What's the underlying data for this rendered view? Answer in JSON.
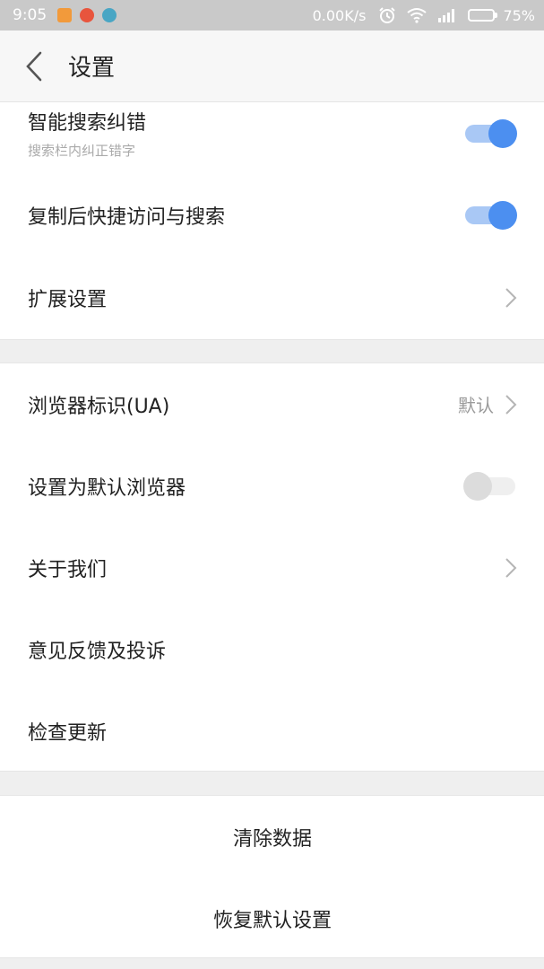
{
  "status_bar": {
    "time": "9:05",
    "network_speed": "0.00K/s",
    "battery": "75%",
    "battery_level": 0.75,
    "notification_icons": [
      "app-notification-icon",
      "weibo-icon",
      "app-notification-icon"
    ],
    "icons": [
      "alarm-icon",
      "wifi-icon",
      "signal-icon",
      "battery-icon"
    ]
  },
  "header": {
    "title": "设置",
    "back_icon": "back-chevron-icon"
  },
  "section1": {
    "smart_correction": {
      "label": "智能搜索纠错",
      "sublabel": "搜索栏内纠正错字",
      "enabled": true
    },
    "copy_quick_access": {
      "label": "复制后快捷访问与搜索",
      "enabled": true
    },
    "extension_settings": {
      "label": "扩展设置"
    }
  },
  "section2": {
    "user_agent": {
      "label": "浏览器标识(UA)",
      "value": "默认"
    },
    "default_browser": {
      "label": "设置为默认浏览器",
      "enabled": false
    },
    "about_us": {
      "label": "关于我们"
    },
    "feedback": {
      "label": "意见反馈及投诉"
    },
    "check_update": {
      "label": "检查更新"
    }
  },
  "section3": {
    "clear_data": "清除数据",
    "restore_defaults": "恢复默认设置"
  },
  "colors": {
    "accent": "#4c8ff0",
    "accent_track": "#a9c8f5",
    "status_bar": "#c9c9c9",
    "background": "#efefef"
  }
}
